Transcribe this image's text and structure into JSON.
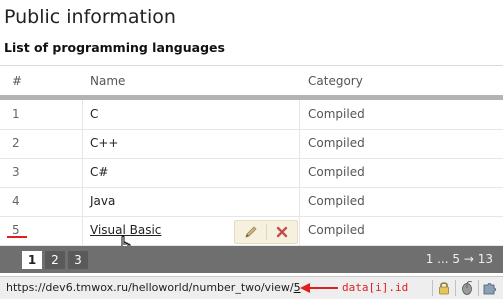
{
  "page": {
    "title": "Public information",
    "section_title": "List of programming languages"
  },
  "table": {
    "headers": {
      "number": "#",
      "name": "Name",
      "category": "Category"
    },
    "rows": [
      {
        "number": "1",
        "name": "C",
        "category": "Compiled"
      },
      {
        "number": "2",
        "name": "C++",
        "category": "Compiled"
      },
      {
        "number": "3",
        "name": "C#",
        "category": "Compiled"
      },
      {
        "number": "4",
        "name": "Java",
        "category": "Compiled"
      },
      {
        "number": "5",
        "name": "Visual Basic",
        "category": "Compiled"
      }
    ],
    "hovered_row": 5,
    "row_action_icons": [
      "pencil-icon",
      "x-icon"
    ]
  },
  "pagination": {
    "pages": [
      "1",
      "2",
      "3"
    ],
    "current_page": "1",
    "summary": "1 ... 5 → 13"
  },
  "status_bar": {
    "url_prefix": "https://dev6.tmwox.ru/helloworld/number_two/view/",
    "url_id": "5",
    "annotation": "data[i].id",
    "icons": [
      "lock-icon",
      "mouse-icon",
      "puzzle-icon"
    ]
  },
  "colors": {
    "pager_background": "#6f6f6f",
    "header_bar": "#b3b3b3",
    "row_actions_background": "#f6f1de",
    "annotation": "#e02020"
  }
}
